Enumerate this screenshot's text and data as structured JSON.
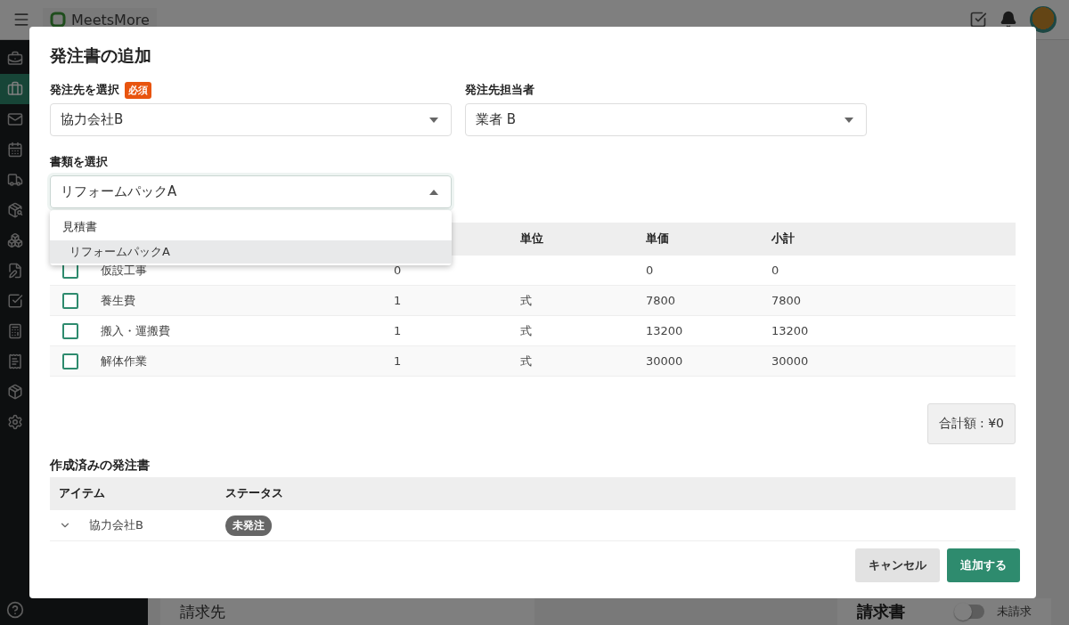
{
  "app": {
    "logo": "MeetsMore",
    "nav": [
      {
        "selected": false
      },
      {
        "selected": true
      },
      {
        "selected": false
      },
      {
        "selected": false
      },
      {
        "selected": false
      },
      {
        "selected": false
      },
      {
        "selected": false
      },
      {
        "selected": false
      },
      {
        "selected": false
      },
      {
        "selected": false
      },
      {
        "selected": false
      },
      {
        "selected": false
      },
      {
        "selected": false
      }
    ],
    "billing_title": "請求先",
    "invoice": {
      "title": "請求書",
      "on": false,
      "status": "未請求"
    }
  },
  "dialog": {
    "title": "発注書の追加",
    "supplier": {
      "label": "発注先を選択",
      "required": "必須",
      "value": "協力会社B"
    },
    "contact": {
      "label": "発注先担当者",
      "value": "業者 B"
    },
    "document": {
      "label": "書類を選択",
      "value": "リフォームパックA",
      "expanded": true,
      "groups": [
        {
          "label": "見積書",
          "options": [
            {
              "label": "リフォームパックA",
              "selected": true
            }
          ]
        }
      ]
    },
    "items": {
      "columns": [
        "単位",
        "単価",
        "小計"
      ],
      "rows": [
        {
          "checked": false,
          "name": "仮設工事",
          "quantity": "0",
          "unit": "",
          "price": "0",
          "subtotal": "0"
        },
        {
          "checked": false,
          "name": "養生費",
          "quantity": "1",
          "unit": "式",
          "price": "7800",
          "subtotal": "7800"
        },
        {
          "checked": false,
          "name": "搬入・運搬費",
          "quantity": "1",
          "unit": "式",
          "price": "13200",
          "subtotal": "13200"
        },
        {
          "checked": false,
          "name": "解体作業",
          "quantity": "1",
          "unit": "式",
          "price": "30000",
          "subtotal": "30000"
        }
      ]
    },
    "total": "合計額 : ¥0",
    "created": {
      "title": "作成済みの発注書",
      "columns": [
        "アイテム",
        "ステータス"
      ],
      "rows": [
        {
          "expanded": false,
          "item": "協力会社B",
          "status": "未発注"
        }
      ]
    },
    "buttons": {
      "cancel": "キャンセル",
      "submit": "追加する"
    }
  }
}
